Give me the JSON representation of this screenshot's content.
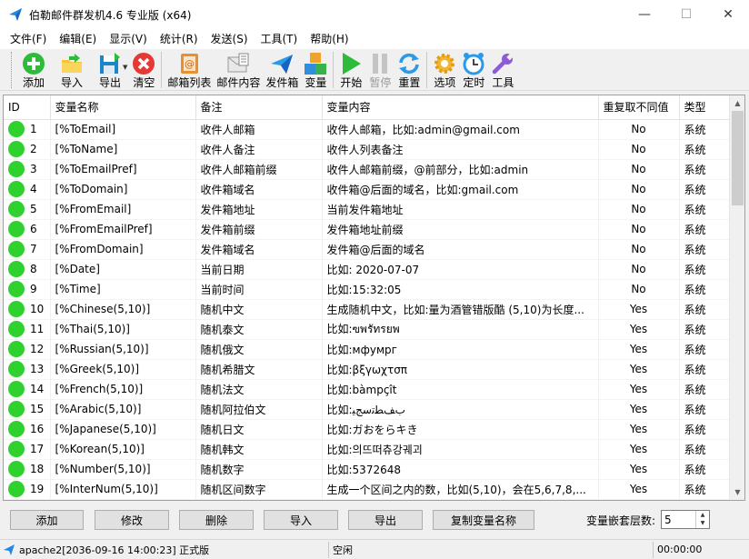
{
  "window": {
    "title": "伯勒邮件群发机4.6 专业版 (x64)",
    "minimize": "—",
    "maximize": "☐",
    "close": "✕"
  },
  "menu": [
    "文件(F)",
    "编辑(E)",
    "显示(V)",
    "统计(R)",
    "发送(S)",
    "工具(T)",
    "帮助(H)"
  ],
  "toolbar": {
    "add": "添加",
    "import": "导入",
    "export": "导出",
    "clear": "清空",
    "mail_list": "邮箱列表",
    "mail_content": "邮件内容",
    "sender": "发件箱",
    "variables": "变量",
    "start": "开始",
    "pause": "暂停",
    "reset": "重置",
    "options": "选项",
    "timer": "定时",
    "tools": "工具"
  },
  "table": {
    "columns": [
      "ID",
      "变量名称",
      "备注",
      "变量内容",
      "重复取不同值",
      "类型"
    ],
    "rows": [
      [
        "1",
        "[%ToEmail]",
        "收件人邮箱",
        "收件人邮箱，比如:admin@gmail.com",
        "No",
        "系统"
      ],
      [
        "2",
        "[%ToName]",
        "收件人备注",
        "收件人列表备注",
        "No",
        "系统"
      ],
      [
        "3",
        "[%ToEmailPref]",
        "收件人邮箱前缀",
        "收件人邮箱前缀，@前部分，比如:admin",
        "No",
        "系统"
      ],
      [
        "4",
        "[%ToDomain]",
        "收件箱域名",
        "收件箱@后面的域名，比如:gmail.com",
        "No",
        "系统"
      ],
      [
        "5",
        "[%FromEmail]",
        "发件箱地址",
        "当前发件箱地址",
        "No",
        "系统"
      ],
      [
        "6",
        "[%FromEmailPref]",
        "发件箱前缀",
        "发件箱地址前缀",
        "No",
        "系统"
      ],
      [
        "7",
        "[%FromDomain]",
        "发件箱域名",
        "发件箱@后面的域名",
        "No",
        "系统"
      ],
      [
        "8",
        "[%Date]",
        "当前日期",
        "比如: 2020-07-07",
        "No",
        "系统"
      ],
      [
        "9",
        "[%Time]",
        "当前时间",
        "比如:15:32:05",
        "No",
        "系统"
      ],
      [
        "10",
        "[%Chinese(5,10)]",
        "随机中文",
        "生成随机中文，比如:量为酒管错版酷 (5,10)为长度...",
        "Yes",
        "系统"
      ],
      [
        "11",
        "[%Thai(5,10)]",
        "随机泰文",
        "比如:ฃพรัทรยพ",
        "Yes",
        "系统"
      ],
      [
        "12",
        "[%Russian(5,10)]",
        "随机俄文",
        "比如:мфумрг",
        "Yes",
        "系统"
      ],
      [
        "13",
        "[%Greek(5,10)]",
        "随机希腊文",
        "比如:βξγωχτσπ",
        "Yes",
        "系统"
      ],
      [
        "14",
        "[%French(5,10)]",
        "随机法文",
        "比如:bàmpçît",
        "Yes",
        "系统"
      ],
      [
        "15",
        "[%Arabic(5,10)]",
        "随机阿拉伯文",
        "比如:ﺏﻒﻄﺗﺳﺞﻴ",
        "Yes",
        "系统"
      ],
      [
        "16",
        "[%Japanese(5,10)]",
        "随机日文",
        "比如:ガおをらキき",
        "Yes",
        "系统"
      ],
      [
        "17",
        "[%Korean(5,10)]",
        "随机韩文",
        "比如:의뜨떠츄강궤괴",
        "Yes",
        "系统"
      ],
      [
        "18",
        "[%Number(5,10)]",
        "随机数字",
        "比如:5372648",
        "Yes",
        "系统"
      ],
      [
        "19",
        "[%InterNum(5,10)]",
        "随机区间数字",
        "生成一个区间之内的数，比如(5,10)，会在5,6,7,8,...",
        "Yes",
        "系统"
      ]
    ]
  },
  "buttons": {
    "add": "添加",
    "modify": "修改",
    "delete": "删除",
    "import": "导入",
    "export": "导出",
    "copy_name": "复制变量名称"
  },
  "nest": {
    "label": "变量嵌套层数:",
    "value": "5"
  },
  "status": {
    "left": "apache2[2036-09-16 14:00:23] 正式版",
    "middle": "空闲",
    "right": "00:00:00"
  },
  "colors": {
    "status_dot": "#2fd12f",
    "accent": "#1e88e5"
  }
}
